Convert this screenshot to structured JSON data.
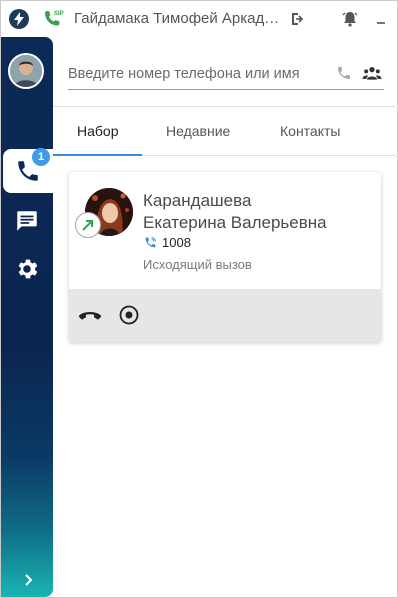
{
  "window": {
    "title": "Гайдамака Тимофей Аркадьевич",
    "sip_badge": "SIP"
  },
  "icons": {
    "app": "lightning-bolt-icon",
    "sip": "phone-sip-icon",
    "logout": "logout-icon",
    "notifications": "bell-icon",
    "minimize": "minimize-icon",
    "dial": "phone-icon",
    "chat": "chat-icon",
    "settings": "gear-icon",
    "expand": "chevron-right-icon",
    "search_phone": "phone-icon",
    "groups": "people-icon",
    "call_direction": "outgoing-arrow-icon",
    "hangup": "hangup-icon",
    "record": "record-icon"
  },
  "sidebar": {
    "dial_badge": "1"
  },
  "search": {
    "placeholder": "Введите номер телефона или имя"
  },
  "tabs": [
    {
      "label": "Набор",
      "active": true
    },
    {
      "label": "Недавние",
      "active": false
    },
    {
      "label": "Контакты",
      "active": false
    }
  ],
  "call": {
    "name_line1": "Карандашева",
    "name_line2": "Екатерина Валерьевна",
    "number": "1008",
    "status": "Исходящий вызов"
  },
  "colors": {
    "accent": "#2f8ee3",
    "badge": "#3d9be9",
    "sip_green": "#3aa34a",
    "outgoing_green": "#2ca84a",
    "sidebar_top": "#0c2a57",
    "sidebar_bottom": "#19b5b5"
  }
}
